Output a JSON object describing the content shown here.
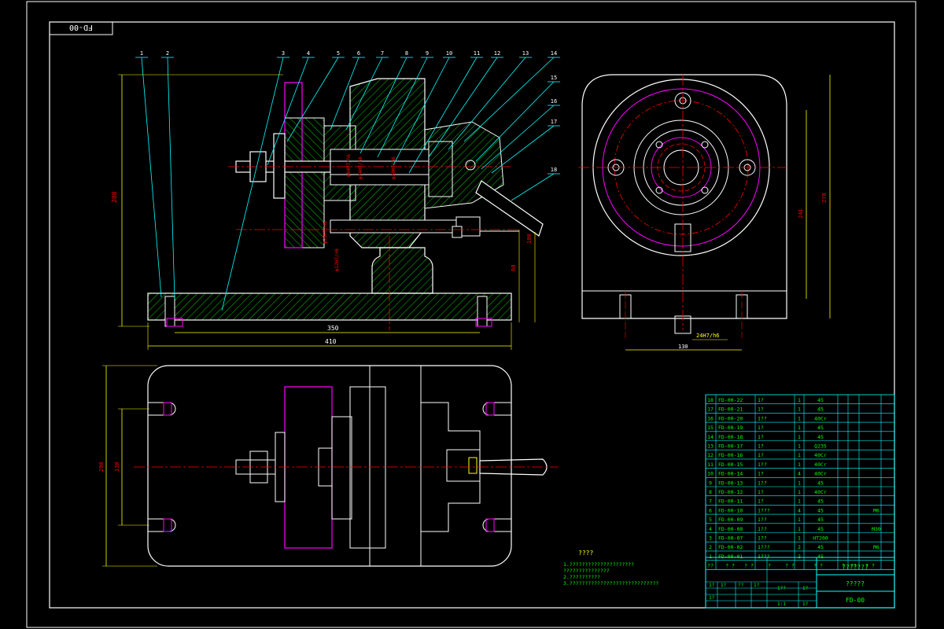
{
  "drawing_code_tab": "FD-00",
  "balloons": [
    "1",
    "2",
    "3",
    "4",
    "5",
    "6",
    "7",
    "8",
    "9",
    "10",
    "11",
    "12",
    "13",
    "14",
    "15",
    "16",
    "17",
    "18"
  ],
  "dims": {
    "front_height": "288",
    "front_len_inner": "350",
    "front_len_total": "410",
    "side_h1": "100",
    "side_h2": "80",
    "side_width": "130",
    "side_fit": "24H7/h6",
    "side_h_total": "270",
    "side_h_inner": "241",
    "plan_width": "290",
    "plan_inner": "130"
  },
  "fits": [
    "φ60H7/h6",
    "φ24H7/h6",
    "φ20H7/h6",
    "φ25H7/n6",
    "φ12H7/n6"
  ],
  "notes": {
    "title": "????",
    "lines": [
      "1.?????????????????????",
      "  ???????????????",
      "2.??????????",
      "3.?????????????????????????????"
    ]
  },
  "bom": [
    {
      "no": "18",
      "code": "FD-00-22",
      "name": "1?",
      "qty": "1",
      "mat": "45",
      "note": ""
    },
    {
      "no": "17",
      "code": "FD-00-21",
      "name": "1?",
      "qty": "1",
      "mat": "45",
      "note": ""
    },
    {
      "no": "16",
      "code": "FD-00-20",
      "name": "1??",
      "qty": "1",
      "mat": "40Cr",
      "note": ""
    },
    {
      "no": "15",
      "code": "FD-00-19",
      "name": "1?",
      "qty": "1",
      "mat": "45",
      "note": ""
    },
    {
      "no": "14",
      "code": "FD-00-18",
      "name": "1?",
      "qty": "1",
      "mat": "45",
      "note": ""
    },
    {
      "no": "13",
      "code": "FD-00-17",
      "name": "1?",
      "qty": "1",
      "mat": "Q235",
      "note": ""
    },
    {
      "no": "12",
      "code": "FD-00-16",
      "name": "1?",
      "qty": "1",
      "mat": "40Cr",
      "note": ""
    },
    {
      "no": "11",
      "code": "FD-00-15",
      "name": "1??",
      "qty": "1",
      "mat": "40Cr",
      "note": ""
    },
    {
      "no": "10",
      "code": "FD-00-14",
      "name": "1?",
      "qty": "4",
      "mat": "40Cr",
      "note": ""
    },
    {
      "no": "9",
      "code": "FD-00-13",
      "name": "1??",
      "qty": "1",
      "mat": "45",
      "note": ""
    },
    {
      "no": "8",
      "code": "FD-00-12",
      "name": "1?",
      "qty": "1",
      "mat": "40Cr",
      "note": ""
    },
    {
      "no": "7",
      "code": "FD-00-11",
      "name": "1?",
      "qty": "1",
      "mat": "45",
      "note": ""
    },
    {
      "no": "6",
      "code": "FD-00-10",
      "name": "1???",
      "qty": "4",
      "mat": "45",
      "note": "M6"
    },
    {
      "no": "5",
      "code": "FD-00-09",
      "name": "1??",
      "qty": "1",
      "mat": "45",
      "note": ""
    },
    {
      "no": "4",
      "code": "FD-00-08",
      "name": "1??",
      "qty": "1",
      "mat": "45",
      "note": "M30"
    },
    {
      "no": "3",
      "code": "FD-00-07",
      "name": "1??",
      "qty": "1",
      "mat": "HT200",
      "note": ""
    },
    {
      "no": "2",
      "code": "FD-00-02",
      "name": "1???",
      "qty": "2",
      "mat": "45",
      "note": "M6"
    },
    {
      "no": "1",
      "code": "FD-00-01",
      "name": "1???",
      "qty": "2",
      "mat": "45",
      "note": ""
    }
  ],
  "bom_header": [
    "??",
    "? ?",
    "? ?",
    "?",
    "? ?",
    "? ?",
    "?",
    "??",
    "? ?"
  ],
  "title_block": {
    "name": "???????",
    "unit": "?????",
    "code": "FD-00",
    "cells": [
      "1?",
      "1?",
      "??",
      "1?",
      "1?",
      "1??",
      "1?",
      "1?",
      "1?",
      "1?",
      "1:1",
      "1?",
      "1?",
      "1?",
      "1?",
      "??(1)",
      "1:1"
    ]
  },
  "colors": {
    "line_white": "#ffffff",
    "line_cyan": "#00ffff",
    "line_yellow": "#ffff00",
    "line_green": "#00ff00",
    "line_red": "#ff0000",
    "line_magenta": "#ff00ff",
    "frame": "#ffffff"
  }
}
